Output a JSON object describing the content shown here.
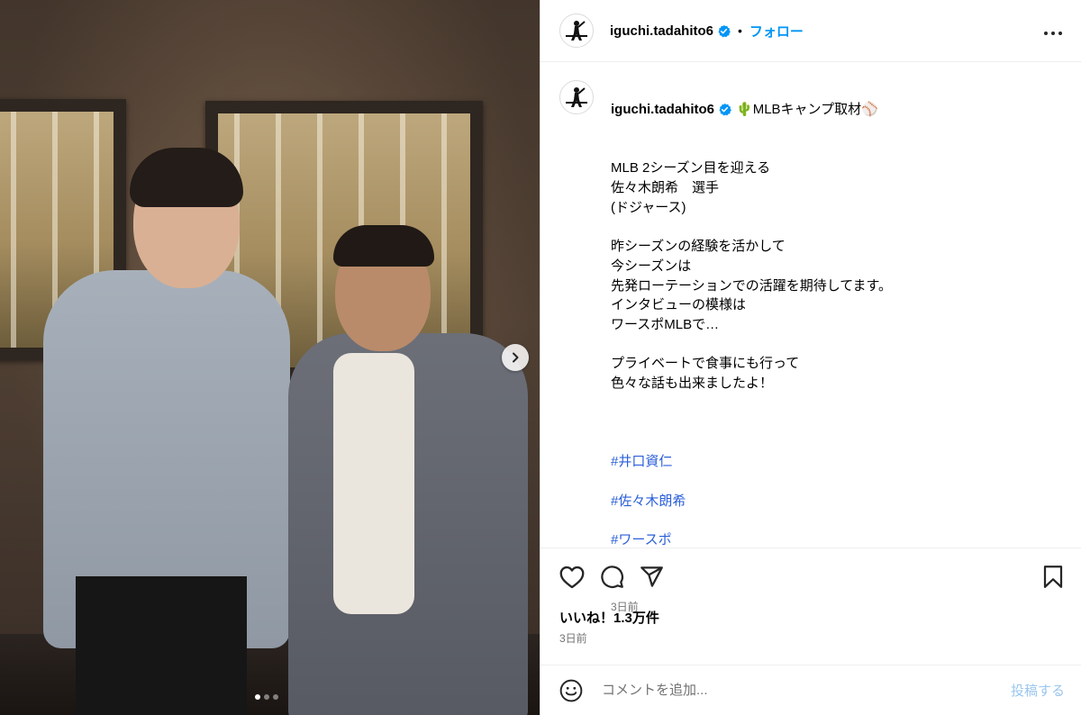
{
  "post": {
    "username": "iguchi.tadahito6",
    "follow_label": "フォロー",
    "separator": "•",
    "more_label": "•••",
    "caption_title": "🌵MLBキャンプ取材⚾",
    "caption_text": "MLB 2シーズン目を迎える\n佐々木朗希　選手\n(ドジャース)\n\n昨シーズンの経験を活かして\n今シーズンは\n先発ローテーションでの活躍を期待してます。\nインタビューの模様は\nワースポMLBで…\n\nプライベートで食事にも行って\n色々な話も出来ましたよ！",
    "hashtags": [
      "#井口資仁",
      "#佐々木朗希",
      "#ワースポ"
    ],
    "caption_time": "3日前",
    "likes": "いいね！1.3万件",
    "post_time": "3日前",
    "comment_placeholder": "コメントを追加...",
    "post_button": "投稿する"
  },
  "media": {
    "slide_count": 3,
    "active_slide": 1
  },
  "icons": {
    "avatar": "avatar-icon",
    "verified": "verified-badge-icon",
    "like": "heart-icon",
    "comment": "comment-icon",
    "share": "share-icon",
    "save": "bookmark-icon",
    "emoji": "emoji-icon",
    "next": "chevron-right-icon"
  },
  "colors": {
    "accent": "#0095f6",
    "hashtag": "#2b5fd9",
    "muted": "#737373",
    "verified": "#0095f6"
  }
}
